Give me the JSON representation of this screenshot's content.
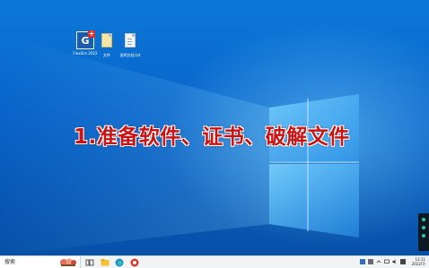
{
  "desktop": {
    "icons": [
      {
        "name": "app-shortcut",
        "caption": "FlexSim 2022",
        "icon": "g-plus-icon"
      },
      {
        "name": "folder-file",
        "caption": "文件",
        "icon": "file-icon"
      },
      {
        "name": "text-file",
        "caption": "说明文档.txt",
        "icon": "document-icon"
      }
    ],
    "overlay_title": "1.准备软件、证书、破解文件"
  },
  "taskbar": {
    "search_placeholder": "搜索",
    "clock_time": "13:11",
    "clock_date": "2022/7/"
  },
  "colors": {
    "accent": "#0a63c8",
    "title_red": "#c81414"
  }
}
